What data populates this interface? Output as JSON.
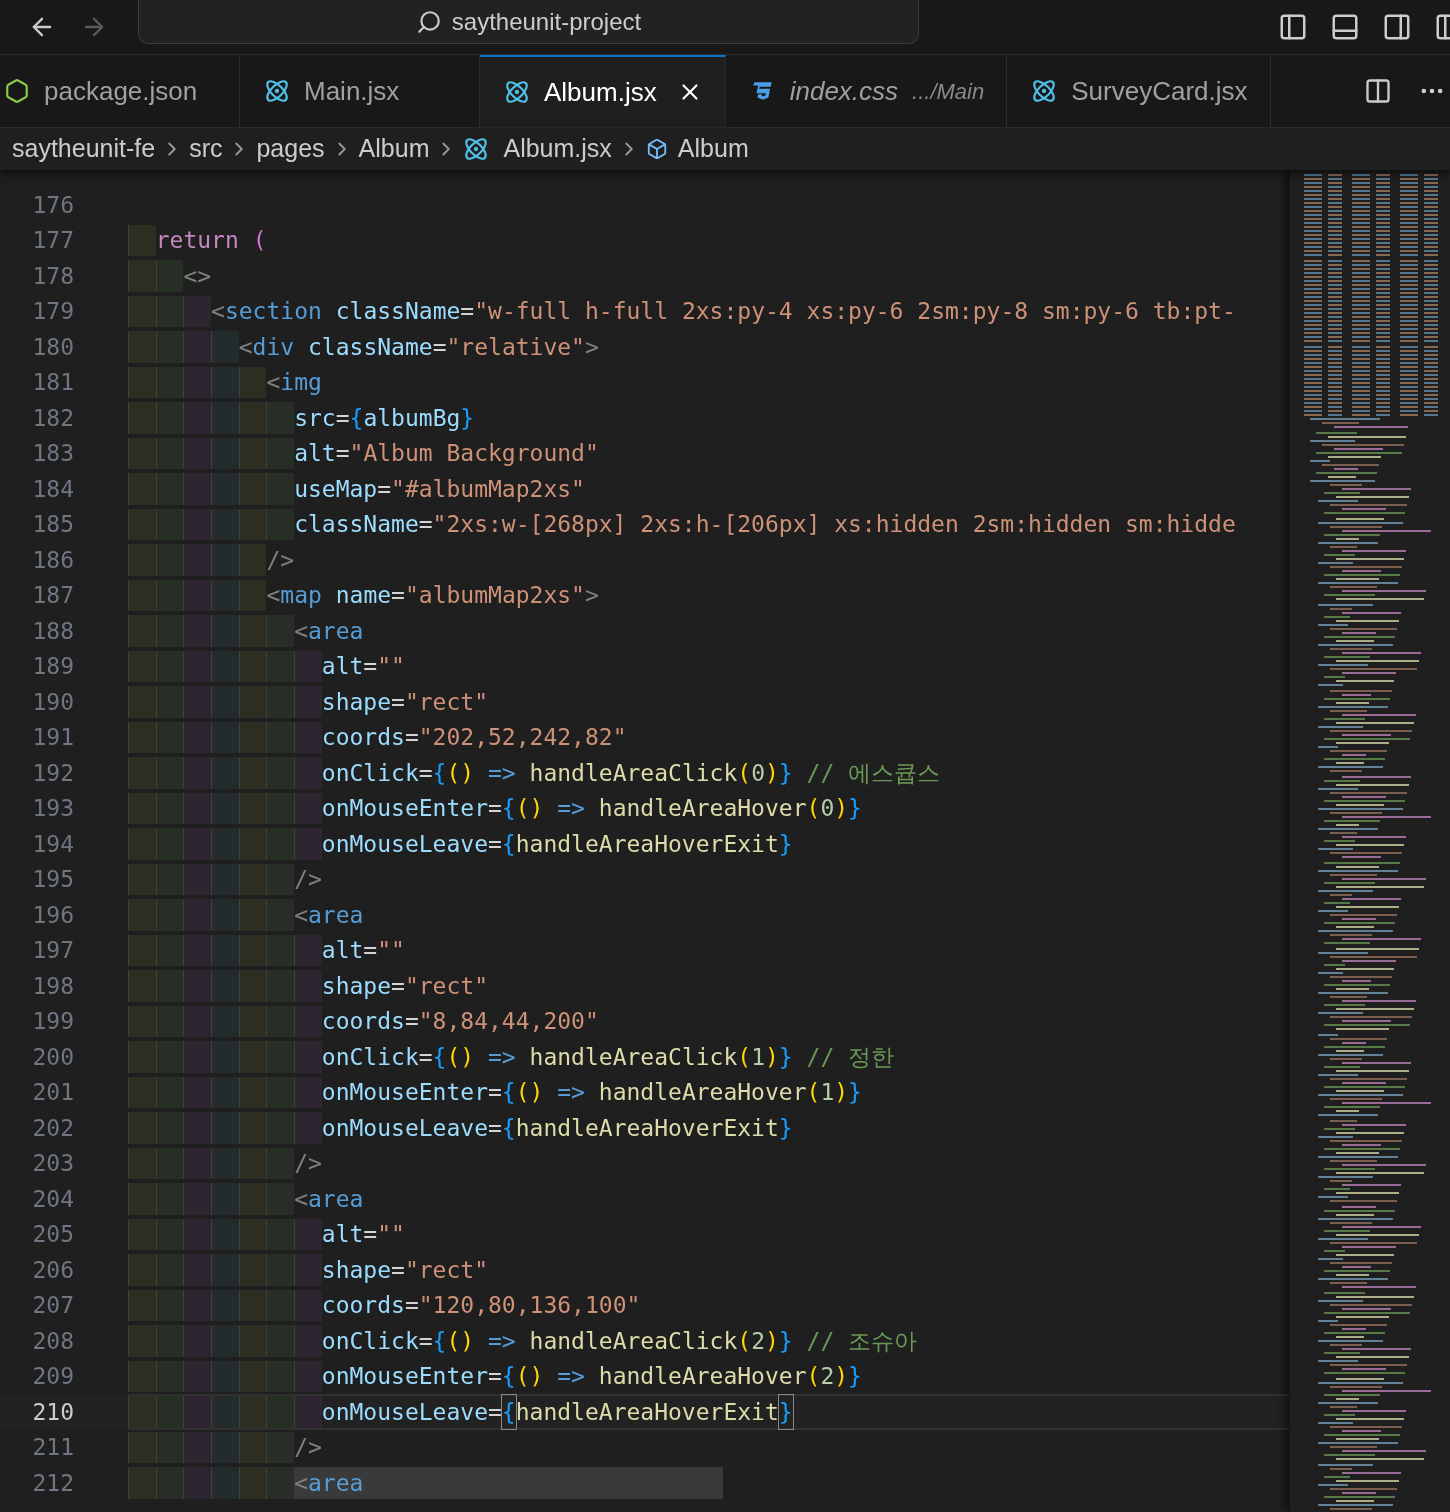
{
  "title_bar": {
    "back_enabled": true,
    "forward_enabled": false,
    "search": "saytheunit-project"
  },
  "tabs": [
    {
      "label": "package.json",
      "kind": "node",
      "selected": false,
      "preview": false
    },
    {
      "label": "Main.jsx",
      "kind": "react",
      "selected": false,
      "preview": false
    },
    {
      "label": "Album.jsx",
      "kind": "react",
      "selected": true,
      "preview": false
    },
    {
      "label": "index.css",
      "description": ".../Main",
      "kind": "css",
      "selected": false,
      "preview": true
    },
    {
      "label": "SurveyCard.jsx",
      "kind": "react",
      "selected": false,
      "preview": false
    }
  ],
  "breadcrumb": [
    {
      "label": "saytheunit-fe",
      "kind": "folder"
    },
    {
      "label": "src",
      "kind": "folder"
    },
    {
      "label": "pages",
      "kind": "folder"
    },
    {
      "label": "Album",
      "kind": "folder"
    },
    {
      "label": "Album.jsx",
      "kind": "file"
    },
    {
      "label": "Album",
      "kind": "symbol"
    }
  ],
  "editor": {
    "lines": [
      {
        "number": "176",
        "current": false
      },
      {
        "number": "177",
        "current": false,
        "highlighted": false,
        "tokens": [
          {
            "text": "  return",
            "kind": "keyword"
          },
          {
            "text": " (",
            "kind": "keyword_paren"
          }
        ]
      },
      {
        "number": "178",
        "current": false,
        "highlighted": false,
        "tokens": [
          {
            "text": "    <>",
            "kind": "punct"
          }
        ]
      },
      {
        "number": "179",
        "current": false,
        "highlighted": false,
        "tokens": [
          {
            "text": "      <",
            "kind": "punct"
          },
          {
            "text": "section",
            "kind": "tag"
          },
          {
            "text": " className",
            "kind": "attr"
          },
          {
            "text": "=",
            "kind": "op"
          },
          {
            "text": "\"w-full h-full 2xs:py-4 xs:py-6 2sm:py-8 sm:py-6 tb:pt-",
            "kind": "string"
          }
        ]
      },
      {
        "number": "180",
        "current": false,
        "highlighted": false,
        "tokens": [
          {
            "text": "        <",
            "kind": "punct"
          },
          {
            "text": "div",
            "kind": "tag"
          },
          {
            "text": " className",
            "kind": "attr"
          },
          {
            "text": "=",
            "kind": "op"
          },
          {
            "text": "\"relative\"",
            "kind": "string"
          },
          {
            "text": ">",
            "kind": "punct"
          }
        ]
      },
      {
        "number": "181",
        "current": false,
        "highlighted": false,
        "tokens": [
          {
            "text": "          <",
            "kind": "punct"
          },
          {
            "text": "img",
            "kind": "tag"
          }
        ]
      },
      {
        "number": "182",
        "current": false,
        "highlighted": false,
        "tokens": [
          {
            "text": "            src",
            "kind": "attr"
          },
          {
            "text": "=",
            "kind": "op"
          },
          {
            "text": "{",
            "kind": "brace",
            "matched": false
          },
          {
            "text": "albumBg",
            "kind": "attr"
          },
          {
            "text": "}",
            "kind": "brace",
            "matched": false
          }
        ]
      },
      {
        "number": "183",
        "current": false,
        "highlighted": false,
        "tokens": [
          {
            "text": "            alt",
            "kind": "attr"
          },
          {
            "text": "=",
            "kind": "op"
          },
          {
            "text": "\"Album Background\"",
            "kind": "string"
          }
        ]
      },
      {
        "number": "184",
        "current": false,
        "highlighted": false,
        "tokens": [
          {
            "text": "            useMap",
            "kind": "attr"
          },
          {
            "text": "=",
            "kind": "op"
          },
          {
            "text": "\"#albumMap2xs\"",
            "kind": "string"
          }
        ]
      },
      {
        "number": "185",
        "current": false,
        "highlighted": false,
        "tokens": [
          {
            "text": "            className",
            "kind": "attr"
          },
          {
            "text": "=",
            "kind": "op"
          },
          {
            "text": "\"2xs:w-[268px] 2xs:h-[206px] xs:hidden 2sm:hidden sm:hidde",
            "kind": "string"
          }
        ]
      },
      {
        "number": "186",
        "current": false,
        "highlighted": false,
        "tokens": [
          {
            "text": "          />",
            "kind": "punct"
          }
        ]
      },
      {
        "number": "187",
        "current": false,
        "highlighted": false,
        "tokens": [
          {
            "text": "          <",
            "kind": "punct"
          },
          {
            "text": "map",
            "kind": "tag"
          },
          {
            "text": " name",
            "kind": "attr"
          },
          {
            "text": "=",
            "kind": "op"
          },
          {
            "text": "\"albumMap2xs\"",
            "kind": "string"
          },
          {
            "text": ">",
            "kind": "punct"
          }
        ]
      },
      {
        "number": "188",
        "current": false,
        "highlighted": false,
        "tokens": [
          {
            "text": "            <",
            "kind": "punct"
          },
          {
            "text": "area",
            "kind": "tag"
          }
        ]
      },
      {
        "number": "189",
        "current": false,
        "highlighted": false,
        "tokens": [
          {
            "text": "              alt",
            "kind": "attr"
          },
          {
            "text": "=",
            "kind": "op"
          },
          {
            "text": "\"\"",
            "kind": "string"
          }
        ]
      },
      {
        "number": "190",
        "current": false,
        "highlighted": false,
        "tokens": [
          {
            "text": "              shape",
            "kind": "attr"
          },
          {
            "text": "=",
            "kind": "op"
          },
          {
            "text": "\"rect\"",
            "kind": "string"
          }
        ]
      },
      {
        "number": "191",
        "current": false,
        "highlighted": false,
        "tokens": [
          {
            "text": "              coords",
            "kind": "attr"
          },
          {
            "text": "=",
            "kind": "op"
          },
          {
            "text": "\"202,52,242,82\"",
            "kind": "string"
          }
        ]
      },
      {
        "number": "192",
        "current": false,
        "highlighted": false,
        "tokens": [
          {
            "text": "              onClick",
            "kind": "attr"
          },
          {
            "text": "=",
            "kind": "op"
          },
          {
            "text": "{",
            "kind": "brace",
            "matched": false
          },
          {
            "text": "()",
            "kind": "paren"
          },
          {
            "text": " =>",
            "kind": "arrow"
          },
          {
            "text": " handleAreaClick",
            "kind": "func"
          },
          {
            "text": "(",
            "kind": "paren"
          },
          {
            "text": "0",
            "kind": "number"
          },
          {
            "text": ")",
            "kind": "paren"
          },
          {
            "text": "}",
            "kind": "brace",
            "matched": false
          },
          {
            "text": " // 에스큡스",
            "kind": "comment"
          }
        ]
      },
      {
        "number": "193",
        "current": false,
        "highlighted": false,
        "tokens": [
          {
            "text": "              onMouseEnter",
            "kind": "attr"
          },
          {
            "text": "=",
            "kind": "op"
          },
          {
            "text": "{",
            "kind": "brace",
            "matched": false
          },
          {
            "text": "()",
            "kind": "paren"
          },
          {
            "text": " =>",
            "kind": "arrow"
          },
          {
            "text": " handleAreaHover",
            "kind": "func"
          },
          {
            "text": "(",
            "kind": "paren"
          },
          {
            "text": "0",
            "kind": "number"
          },
          {
            "text": ")",
            "kind": "paren"
          },
          {
            "text": "}",
            "kind": "brace",
            "matched": false
          }
        ]
      },
      {
        "number": "194",
        "current": false,
        "highlighted": false,
        "tokens": [
          {
            "text": "              onMouseLeave",
            "kind": "attr"
          },
          {
            "text": "=",
            "kind": "op"
          },
          {
            "text": "{",
            "kind": "brace",
            "matched": false
          },
          {
            "text": "handleAreaHoverExit",
            "kind": "func"
          },
          {
            "text": "}",
            "kind": "brace",
            "matched": false
          }
        ]
      },
      {
        "number": "195",
        "current": false,
        "highlighted": false,
        "tokens": [
          {
            "text": "            />",
            "kind": "punct"
          }
        ]
      },
      {
        "number": "196",
        "current": false,
        "highlighted": false,
        "tokens": [
          {
            "text": "            <",
            "kind": "punct"
          },
          {
            "text": "area",
            "kind": "tag"
          }
        ]
      },
      {
        "number": "197",
        "current": false,
        "highlighted": false,
        "tokens": [
          {
            "text": "              alt",
            "kind": "attr"
          },
          {
            "text": "=",
            "kind": "op"
          },
          {
            "text": "\"\"",
            "kind": "string"
          }
        ]
      },
      {
        "number": "198",
        "current": false,
        "highlighted": false,
        "tokens": [
          {
            "text": "              shape",
            "kind": "attr"
          },
          {
            "text": "=",
            "kind": "op"
          },
          {
            "text": "\"rect\"",
            "kind": "string"
          }
        ]
      },
      {
        "number": "199",
        "current": false,
        "highlighted": false,
        "tokens": [
          {
            "text": "              coords",
            "kind": "attr"
          },
          {
            "text": "=",
            "kind": "op"
          },
          {
            "text": "\"8,84,44,200\"",
            "kind": "string"
          }
        ]
      },
      {
        "number": "200",
        "current": false,
        "highlighted": false,
        "tokens": [
          {
            "text": "              onClick",
            "kind": "attr"
          },
          {
            "text": "=",
            "kind": "op"
          },
          {
            "text": "{",
            "kind": "brace",
            "matched": false
          },
          {
            "text": "()",
            "kind": "paren"
          },
          {
            "text": " =>",
            "kind": "arrow"
          },
          {
            "text": " handleAreaClick",
            "kind": "func"
          },
          {
            "text": "(",
            "kind": "paren"
          },
          {
            "text": "1",
            "kind": "number"
          },
          {
            "text": ")",
            "kind": "paren"
          },
          {
            "text": "}",
            "kind": "brace",
            "matched": false
          },
          {
            "text": " // 정한",
            "kind": "comment"
          }
        ]
      },
      {
        "number": "201",
        "current": false,
        "highlighted": false,
        "tokens": [
          {
            "text": "              onMouseEnter",
            "kind": "attr"
          },
          {
            "text": "=",
            "kind": "op"
          },
          {
            "text": "{",
            "kind": "brace",
            "matched": false
          },
          {
            "text": "()",
            "kind": "paren"
          },
          {
            "text": " =>",
            "kind": "arrow"
          },
          {
            "text": " handleAreaHover",
            "kind": "func"
          },
          {
            "text": "(",
            "kind": "paren"
          },
          {
            "text": "1",
            "kind": "number"
          },
          {
            "text": ")",
            "kind": "paren"
          },
          {
            "text": "}",
            "kind": "brace",
            "matched": false
          }
        ]
      },
      {
        "number": "202",
        "current": false,
        "highlighted": false,
        "tokens": [
          {
            "text": "              onMouseLeave",
            "kind": "attr"
          },
          {
            "text": "=",
            "kind": "op"
          },
          {
            "text": "{",
            "kind": "brace",
            "matched": false
          },
          {
            "text": "handleAreaHoverExit",
            "kind": "func"
          },
          {
            "text": "}",
            "kind": "brace",
            "matched": false
          }
        ]
      },
      {
        "number": "203",
        "current": false,
        "highlighted": false,
        "tokens": [
          {
            "text": "            />",
            "kind": "punct"
          }
        ]
      },
      {
        "number": "204",
        "current": false,
        "highlighted": false,
        "tokens": [
          {
            "text": "            <",
            "kind": "punct"
          },
          {
            "text": "area",
            "kind": "tag"
          }
        ]
      },
      {
        "number": "205",
        "current": false,
        "highlighted": false,
        "tokens": [
          {
            "text": "              alt",
            "kind": "attr"
          },
          {
            "text": "=",
            "kind": "op"
          },
          {
            "text": "\"\"",
            "kind": "string"
          }
        ]
      },
      {
        "number": "206",
        "current": false,
        "highlighted": false,
        "tokens": [
          {
            "text": "              shape",
            "kind": "attr"
          },
          {
            "text": "=",
            "kind": "op"
          },
          {
            "text": "\"rect\"",
            "kind": "string"
          }
        ]
      },
      {
        "number": "207",
        "current": false,
        "highlighted": false,
        "tokens": [
          {
            "text": "              coords",
            "kind": "attr"
          },
          {
            "text": "=",
            "kind": "op"
          },
          {
            "text": "\"120,80,136,100\"",
            "kind": "string"
          }
        ]
      },
      {
        "number": "208",
        "current": false,
        "highlighted": false,
        "tokens": [
          {
            "text": "              onClick",
            "kind": "attr"
          },
          {
            "text": "=",
            "kind": "op"
          },
          {
            "text": "{",
            "kind": "brace",
            "matched": false
          },
          {
            "text": "()",
            "kind": "paren"
          },
          {
            "text": " =>",
            "kind": "arrow"
          },
          {
            "text": " handleAreaClick",
            "kind": "func"
          },
          {
            "text": "(",
            "kind": "paren"
          },
          {
            "text": "2",
            "kind": "number"
          },
          {
            "text": ")",
            "kind": "paren"
          },
          {
            "text": "}",
            "kind": "brace",
            "matched": false
          },
          {
            "text": " // 조슈아",
            "kind": "comment"
          }
        ]
      },
      {
        "number": "209",
        "current": false,
        "highlighted": false,
        "tokens": [
          {
            "text": "              onMouseEnter",
            "kind": "attr"
          },
          {
            "text": "=",
            "kind": "op"
          },
          {
            "text": "{",
            "kind": "brace",
            "matched": false
          },
          {
            "text": "()",
            "kind": "paren"
          },
          {
            "text": " =>",
            "kind": "arrow"
          },
          {
            "text": " handleAreaHover",
            "kind": "func"
          },
          {
            "text": "(",
            "kind": "paren"
          },
          {
            "text": "2",
            "kind": "number"
          },
          {
            "text": ")",
            "kind": "paren"
          },
          {
            "text": "}",
            "kind": "brace",
            "matched": false
          }
        ]
      },
      {
        "number": "210",
        "current": true,
        "highlighted": false,
        "tokens": [
          {
            "text": "              onMouseLeave",
            "kind": "attr"
          },
          {
            "text": "=",
            "kind": "op"
          },
          {
            "text": "{",
            "kind": "brace",
            "matched": true
          },
          {
            "text": "handleAreaHoverExit",
            "kind": "func"
          },
          {
            "text": "}",
            "kind": "brace",
            "matched": true
          }
        ]
      },
      {
        "number": "211",
        "current": false,
        "highlighted": false,
        "tokens": [
          {
            "text": "            />",
            "kind": "punct"
          }
        ]
      },
      {
        "number": "212",
        "current": false,
        "highlighted": true,
        "tokens": [
          {
            "text": "            <",
            "kind": "punct"
          },
          {
            "text": "area",
            "kind": "tag"
          }
        ]
      }
    ]
  }
}
